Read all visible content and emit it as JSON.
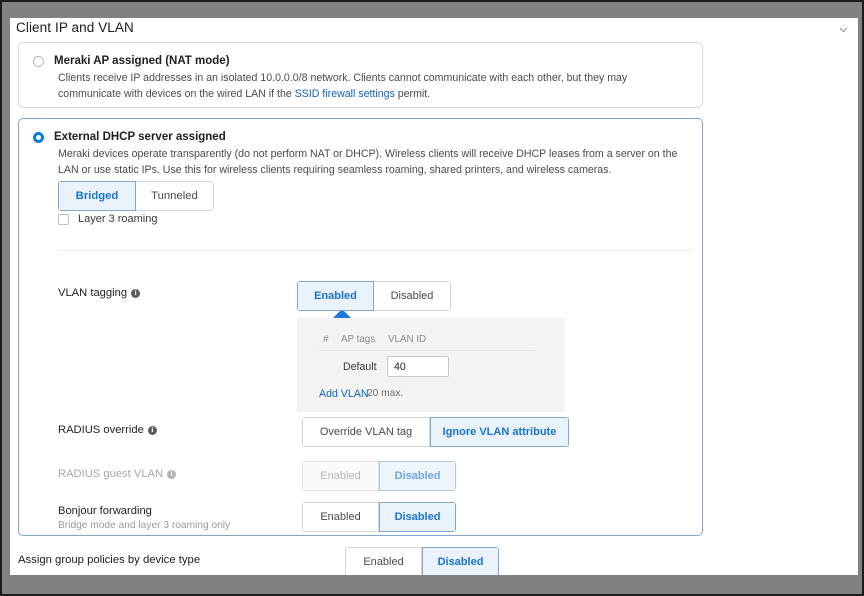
{
  "window": {
    "title": "Client IP and VLAN",
    "collapse_icon": "chevron-down-icon"
  },
  "options": {
    "nat": {
      "label": "Meraki AP assigned (NAT mode)",
      "selected": false,
      "description_part1": "Clients receive IP addresses in an isolated 10.0.0.0/8 network. Clients cannot communicate with each other, but they may communicate with devices on the wired LAN if the ",
      "link_text": "SSID firewall settings",
      "description_part2": " permit."
    },
    "dhcp": {
      "label": "External DHCP server assigned",
      "selected": true,
      "description": "Meraki devices operate transparently (do not perform NAT or DHCP). Wireless clients will receive DHCP leases from a server on the LAN or use static IPs. Use this for wireless clients requiring seamless roaming, shared printers, and wireless cameras.",
      "mode_toggle": {
        "options": [
          "Bridged",
          "Tunneled"
        ],
        "selected": "Bridged"
      },
      "layer3_roaming": {
        "label": "Layer 3 roaming",
        "checked": false
      }
    }
  },
  "settings": {
    "vlan_tagging": {
      "label": "VLAN tagging",
      "info_icon": "info-icon",
      "options": [
        "Enabled",
        "Disabled"
      ],
      "selected": "Enabled",
      "table": {
        "headers": [
          "#",
          "AP tags",
          "VLAN ID"
        ],
        "rows": [
          {
            "tag": "Default",
            "vlan_id": "40"
          }
        ],
        "add_link": "Add VLAN",
        "max_note": "20 max."
      }
    },
    "radius_override": {
      "label": "RADIUS override",
      "info_icon": "info-icon",
      "options": [
        "Override VLAN tag",
        "Ignore VLAN attribute"
      ],
      "selected": "Ignore VLAN attribute"
    },
    "radius_guest_vlan": {
      "label": "RADIUS guest VLAN",
      "info_icon": "info-icon",
      "options": [
        "Enabled",
        "Disabled"
      ],
      "selected": "Disabled",
      "disabled": true
    },
    "bonjour_forwarding": {
      "label": "Bonjour forwarding",
      "sublabel": "Bridge mode and layer 3 roaming only",
      "options": [
        "Enabled",
        "Disabled"
      ],
      "selected": "Disabled"
    }
  },
  "bottom": {
    "label": "Assign group policies by device type",
    "options": [
      "Enabled",
      "Disabled"
    ],
    "selected": "Disabled"
  },
  "colors": {
    "accent_blue": "#1a73d2",
    "link_blue": "#1166bb",
    "active_bg": "#eaf3fc",
    "active_border": "#7fa8cc",
    "frame_grey": "#808184"
  }
}
